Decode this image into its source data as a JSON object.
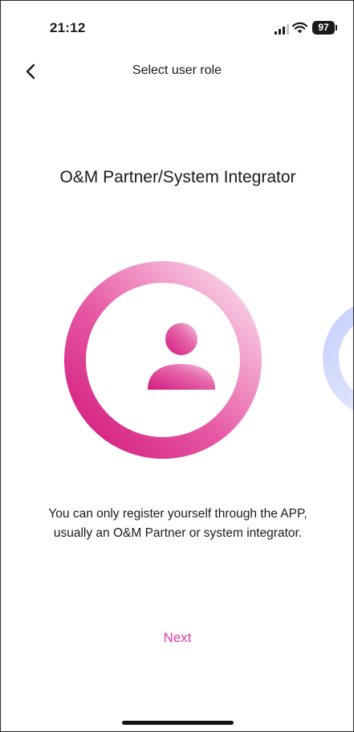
{
  "status_bar": {
    "time": "21:12",
    "battery_level": "97",
    "icons": [
      "signal-icon",
      "wifi-icon",
      "battery-icon"
    ]
  },
  "nav": {
    "back_icon": "chevron-left-icon",
    "title": "Select user role"
  },
  "role": {
    "title": "O&M Partner/System Integrator",
    "avatar_icon": "user-icon",
    "description": "You can only register yourself through the APP, usually an O&M Partner or system integrator.",
    "next_label": "Next"
  },
  "colors": {
    "accent": "#e03aa8",
    "ring_dark": "#d4197f",
    "ring_light": "#fbe3f0",
    "next_role_ring": "#cfd6fb"
  }
}
